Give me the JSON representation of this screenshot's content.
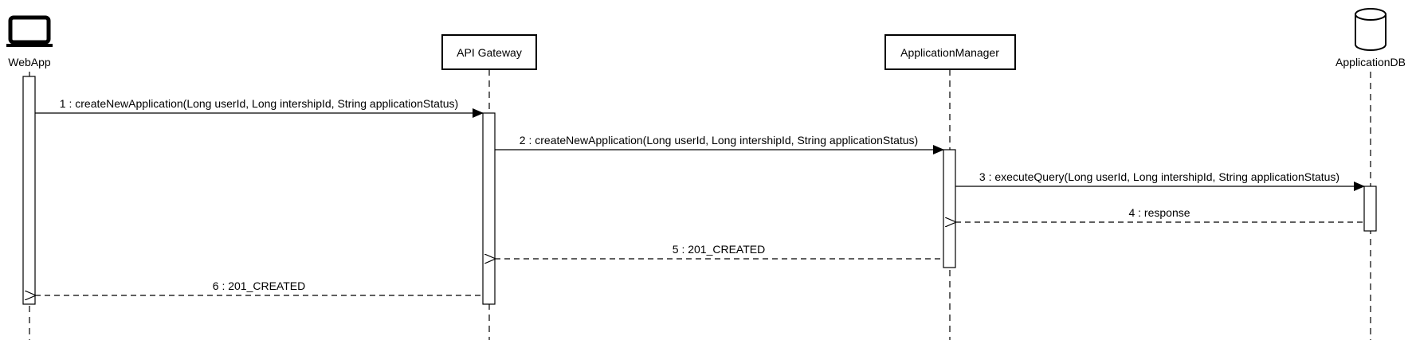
{
  "participants": {
    "webapp": {
      "label": "WebApp",
      "icon": "laptop-icon"
    },
    "gateway": {
      "label": "API Gateway"
    },
    "manager": {
      "label": "ApplicationManager"
    },
    "db": {
      "label": "ApplicationDB",
      "icon": "database-icon"
    }
  },
  "messages": [
    {
      "label": "1 : createNewApplication(Long userId, Long intershipId, String applicationStatus)",
      "from": "WebApp",
      "to": "API Gateway",
      "style": "sync"
    },
    {
      "label": "2 : createNewApplication(Long userId, Long intershipId, String applicationStatus)",
      "from": "API Gateway",
      "to": "ApplicationManager",
      "style": "sync"
    },
    {
      "label": "3 : executeQuery(Long userId, Long intershipId, String applicationStatus)",
      "from": "ApplicationManager",
      "to": "ApplicationDB",
      "style": "sync"
    },
    {
      "label": "4 : response",
      "from": "ApplicationDB",
      "to": "ApplicationManager",
      "style": "return"
    },
    {
      "label": "5 : 201_CREATED",
      "from": "ApplicationManager",
      "to": "API Gateway",
      "style": "return"
    },
    {
      "label": "6 : 201_CREATED",
      "from": "API Gateway",
      "to": "WebApp",
      "style": "return"
    }
  ]
}
